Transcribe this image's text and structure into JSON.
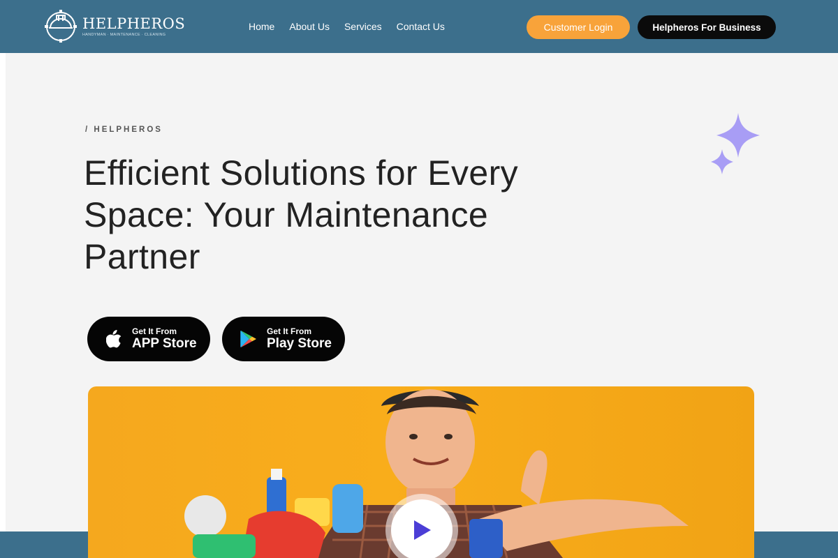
{
  "brand": {
    "name": "HELPHEROS",
    "tagline": "HANDYMAN · MAINTENANCE · CLEANING"
  },
  "nav": {
    "items": [
      {
        "label": "Home"
      },
      {
        "label": "About Us"
      },
      {
        "label": "Services"
      },
      {
        "label": "Contact Us"
      }
    ]
  },
  "header": {
    "login_label": "Customer Login",
    "business_label": "Helpheros For Business"
  },
  "hero": {
    "eyebrow": "/ HELPHEROS",
    "headline": "Efficient Solutions for Every Space: Your Maintenance Partner",
    "app_store": {
      "small": "Get It From",
      "big": "APP Store"
    },
    "play_store": {
      "small": "Get It From",
      "big": "Play Store"
    }
  },
  "icons": {
    "logo": "helmet-gear-icon",
    "apple": "apple-icon",
    "google_play": "google-play-icon",
    "sparkle": "sparkle-icon",
    "play": "play-icon"
  },
  "colors": {
    "header_bg": "#3c6f8c",
    "login_bg": "#f8a33a",
    "business_bg": "#0b0b0b",
    "sparkle": "#a89df5",
    "play_triangle": "#4b3ed6",
    "image_bg": "#f5a81e"
  }
}
